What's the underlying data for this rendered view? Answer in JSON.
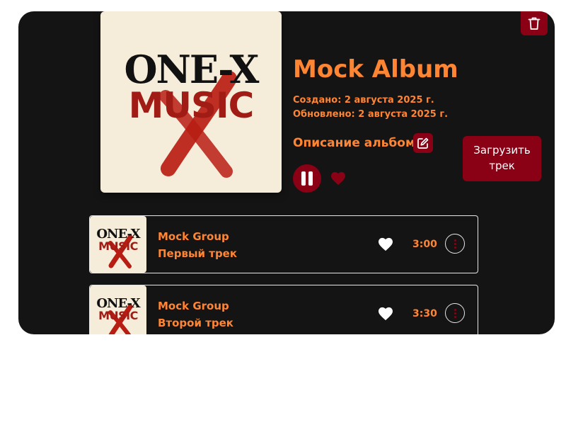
{
  "album": {
    "cover_logo_top": "ONE-X",
    "cover_logo_bottom": "MUSIC",
    "title": "Mock Album",
    "created": "Создано: 2 августа 2025 г.",
    "updated": "Обновлено: 2 августа 2025 г.",
    "description_label": "Описание альбома"
  },
  "actions": {
    "upload_label": "Загрузить трек",
    "delete_icon": "trash-icon",
    "edit_icon": "edit-icon",
    "play_state": "pause-icon",
    "like_icon": "heart-icon"
  },
  "tracks": [
    {
      "logo_top": "ONE-X",
      "logo_bottom": "MUSIC",
      "artist": "Mock Group",
      "title": "Первый трек",
      "duration": "3:00"
    },
    {
      "logo_top": "ONE-X",
      "logo_bottom": "MUSIC",
      "artist": "Mock Group",
      "title": "Второй трек",
      "duration": "3:30"
    }
  ],
  "colors": {
    "panel_bg": "#141414",
    "accent_orange": "#ff8533",
    "accent_red": "#8a0015"
  }
}
